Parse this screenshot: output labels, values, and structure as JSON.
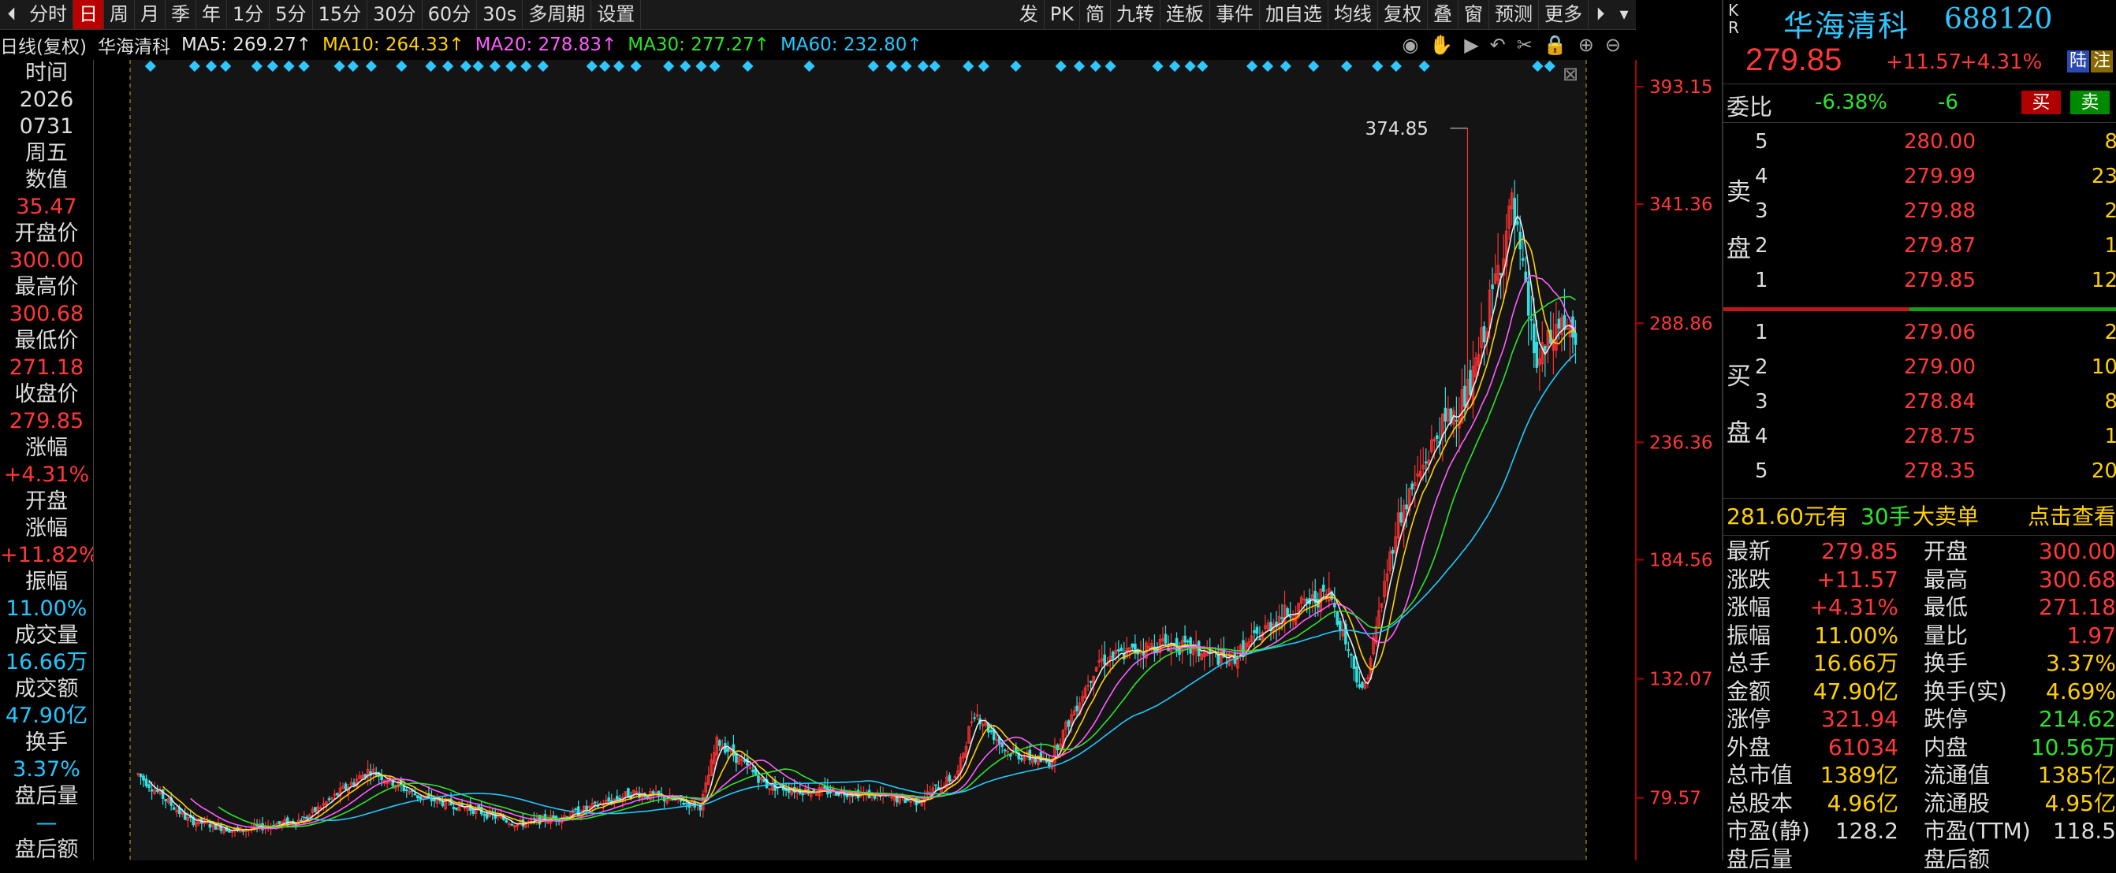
{
  "toolbar": {
    "left_items": [
      "分时",
      "日",
      "周",
      "月",
      "季",
      "年",
      "1分",
      "5分",
      "15分",
      "30分",
      "60分",
      "30s",
      "多周期",
      "设置"
    ],
    "active_index": 1,
    "right_items": [
      "发",
      "PK",
      "简",
      "九转",
      "连板",
      "事件",
      "加自选",
      "均线",
      "复权",
      "叠",
      "窗",
      "预测",
      "更多"
    ]
  },
  "ma_bar": {
    "prefix": "日线(复权)",
    "stock": "华海清科",
    "ma5": "MA5: 269.27↑",
    "ma10": "MA10: 264.33↑",
    "ma20": "MA20: 278.83↑",
    "ma30": "MA30: 277.27↑",
    "ma60": "MA60: 232.80↑",
    "colors": {
      "ma5": "#e8e8e8",
      "ma10": "#ffd000",
      "ma20": "#ff5cff",
      "ma30": "#2ee22e",
      "ma60": "#22c8ff"
    }
  },
  "left_panel": [
    {
      "text": "时间",
      "cls": "lp-label"
    },
    {
      "text": "2026",
      "cls": "lp-label"
    },
    {
      "text": "0731",
      "cls": "lp-label"
    },
    {
      "text": "周五",
      "cls": "lp-label"
    },
    {
      "text": "数值",
      "cls": "lp-label"
    },
    {
      "text": "35.47",
      "cls": "lp-red"
    },
    {
      "text": "开盘价",
      "cls": "lp-label"
    },
    {
      "text": "300.00",
      "cls": "lp-red"
    },
    {
      "text": "最高价",
      "cls": "lp-label"
    },
    {
      "text": "300.68",
      "cls": "lp-red"
    },
    {
      "text": "最低价",
      "cls": "lp-label"
    },
    {
      "text": "271.18",
      "cls": "lp-red"
    },
    {
      "text": "收盘价",
      "cls": "lp-label"
    },
    {
      "text": "279.85",
      "cls": "lp-red"
    },
    {
      "text": "涨幅",
      "cls": "lp-label"
    },
    {
      "text": "+4.31%",
      "cls": "lp-red"
    },
    {
      "text": "开盘",
      "cls": "lp-label"
    },
    {
      "text": "涨幅",
      "cls": "lp-label"
    },
    {
      "text": "+11.82%",
      "cls": "lp-red"
    },
    {
      "text": "振幅",
      "cls": "lp-label"
    },
    {
      "text": "11.00%",
      "cls": "lp-cyan"
    },
    {
      "text": "成交量",
      "cls": "lp-label"
    },
    {
      "text": "16.66万",
      "cls": "lp-cyan"
    },
    {
      "text": "成交额",
      "cls": "lp-label"
    },
    {
      "text": "47.90亿",
      "cls": "lp-cyan"
    },
    {
      "text": "换手",
      "cls": "lp-label"
    },
    {
      "text": "3.37%",
      "cls": "lp-cyan"
    },
    {
      "text": "盘后量",
      "cls": "lp-label"
    },
    {
      "text": "—",
      "cls": "lp-cyan"
    },
    {
      "text": "盘后额",
      "cls": "lp-label"
    }
  ],
  "chart": {
    "y_ticks": [
      "393.15",
      "341.36",
      "288.86",
      "236.36",
      "184.56",
      "132.07",
      "79.57"
    ],
    "y_tick_values": [
      393.15,
      341.36,
      288.86,
      236.36,
      184.56,
      132.07,
      79.57
    ],
    "high_label": "374.85",
    "y_min": 52,
    "y_max": 405
  },
  "quote": {
    "kr": "K\nR",
    "name": "华海清科",
    "code": "688120",
    "last": "279.85",
    "change": "+11.57",
    "pct": "+4.31%",
    "tag1": "陆",
    "tag2": "注",
    "weibi_label": "委比",
    "weibi_pct": "-6.38%",
    "weibi_val": "-6",
    "buy_btn": "买",
    "sell_btn": "卖",
    "sell_label": "卖盘",
    "buy_label": "买盘",
    "asks": [
      {
        "idx": "5",
        "price": "280.00",
        "vol": "8"
      },
      {
        "idx": "4",
        "price": "279.99",
        "vol": "23"
      },
      {
        "idx": "3",
        "price": "279.88",
        "vol": "2"
      },
      {
        "idx": "2",
        "price": "279.87",
        "vol": "1"
      },
      {
        "idx": "1",
        "price": "279.85",
        "vol": "12"
      }
    ],
    "bids": [
      {
        "idx": "1",
        "price": "279.06",
        "vol": "2"
      },
      {
        "idx": "2",
        "price": "279.00",
        "vol": "10"
      },
      {
        "idx": "3",
        "price": "278.84",
        "vol": "8"
      },
      {
        "idx": "4",
        "price": "278.75",
        "vol": "1"
      },
      {
        "idx": "5",
        "price": "278.35",
        "vol": "20"
      }
    ],
    "bigorder": {
      "price": "281.60元有",
      "qty": "30手",
      "label": "大卖单",
      "link": "点击查看"
    },
    "stats": [
      {
        "l1": "最新",
        "v1": "279.85",
        "c1": "red",
        "l2": "开盘",
        "v2": "300.00",
        "c2": "red"
      },
      {
        "l1": "涨跌",
        "v1": "+11.57",
        "c1": "red",
        "l2": "最高",
        "v2": "300.68",
        "c2": "red"
      },
      {
        "l1": "涨幅",
        "v1": "+4.31%",
        "c1": "red",
        "l2": "最低",
        "v2": "271.18",
        "c2": "red"
      },
      {
        "l1": "振幅",
        "v1": "11.00%",
        "c1": "yellow",
        "l2": "量比",
        "v2": "1.97",
        "c2": "red"
      },
      {
        "l1": "总手",
        "v1": "16.66万",
        "c1": "yellow",
        "l2": "换手",
        "v2": "3.37%",
        "c2": "yellow"
      },
      {
        "l1": "金额",
        "v1": "47.90亿",
        "c1": "yellow",
        "l2": "换手(实)",
        "v2": "4.69%",
        "c2": "yellow"
      },
      {
        "l1": "涨停",
        "v1": "321.94",
        "c1": "red",
        "l2": "跌停",
        "v2": "214.62",
        "c2": "green"
      },
      {
        "l1": "外盘",
        "v1": "61034",
        "c1": "red",
        "l2": "内盘",
        "v2": "10.56万",
        "c2": "green"
      },
      {
        "l1": "总市值",
        "v1": "1389亿",
        "c1": "yellow",
        "l2": "流通值",
        "v2": "1385亿",
        "c2": "yellow"
      },
      {
        "l1": "总股本",
        "v1": "4.96亿",
        "c1": "yellow",
        "l2": "流通股",
        "v2": "4.95亿",
        "c2": "yellow"
      },
      {
        "l1": "市盈(静)",
        "v1": "128.2",
        "c1": "white",
        "l2": "市盈(TTM)",
        "v2": "118.5",
        "c2": "white"
      },
      {
        "l1": "盘后量",
        "v1": "",
        "c1": "white",
        "l2": "盘后额",
        "v2": "",
        "c2": "white"
      }
    ]
  }
}
